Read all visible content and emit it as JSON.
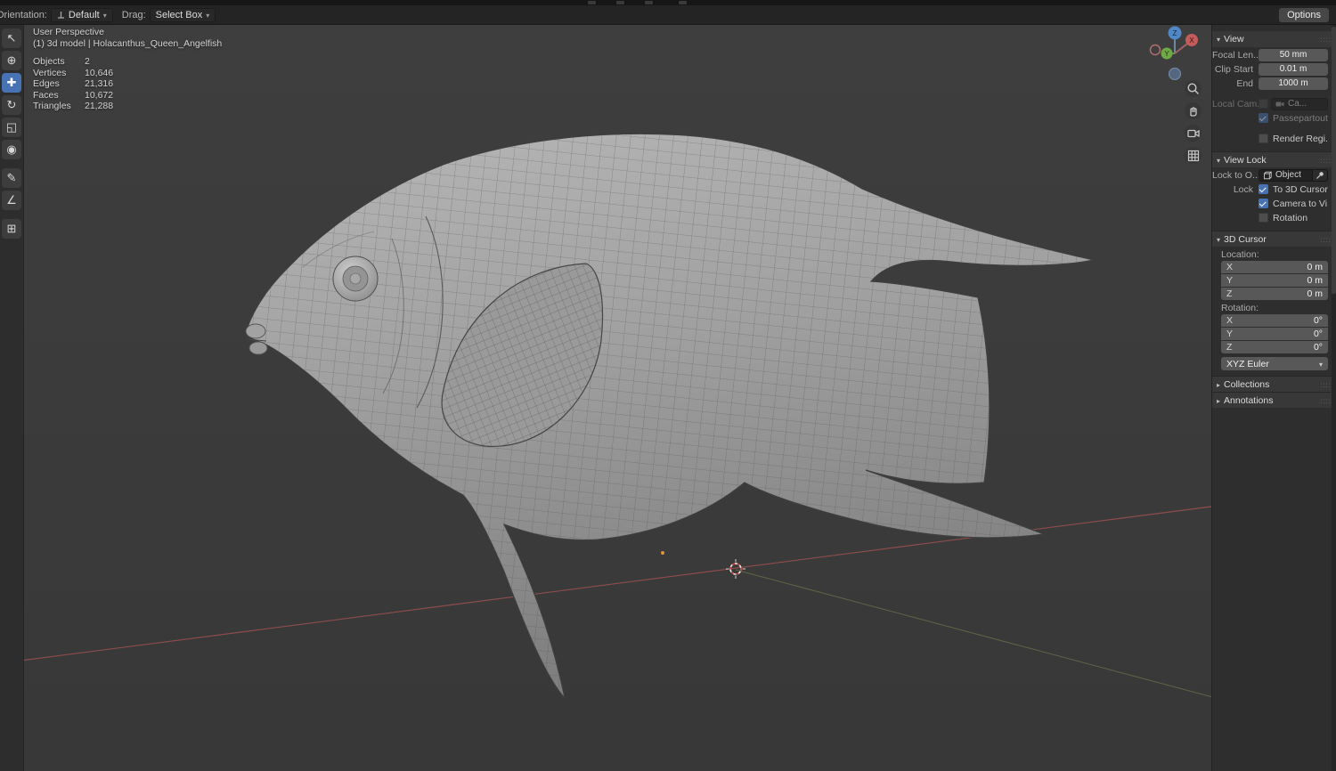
{
  "colors": {
    "accent": "#4772b3",
    "axis_x": "#b14d4d",
    "axis_y": "#7d8f55",
    "viewport_bg": "#3b3b3b"
  },
  "header": {
    "orientation_label": "Orientation:",
    "orientation_value": "Default",
    "drag_label": "Drag:",
    "drag_value": "Select Box",
    "options_button": "Options"
  },
  "toolbar": {
    "tools": [
      {
        "name": "select-box",
        "glyph": "↖"
      },
      {
        "name": "cursor",
        "glyph": "⊕"
      },
      {
        "name": "move",
        "glyph": "✚"
      },
      {
        "name": "rotate",
        "glyph": "↻"
      },
      {
        "name": "scale",
        "glyph": "◱"
      },
      {
        "name": "transform",
        "glyph": "◉"
      },
      {
        "name": "annotate",
        "glyph": "✎"
      },
      {
        "name": "measure",
        "glyph": "∠"
      },
      {
        "name": "add-cube",
        "glyph": "⊞"
      }
    ]
  },
  "overlay": {
    "perspective": "User Perspective",
    "scene": "(1) 3d model | Holacanthus_Queen_Angelfish",
    "stats": [
      {
        "label": "Objects",
        "value": "2"
      },
      {
        "label": "Vertices",
        "value": "10,646"
      },
      {
        "label": "Edges",
        "value": "21,316"
      },
      {
        "label": "Faces",
        "value": "10,672"
      },
      {
        "label": "Triangles",
        "value": "21,288"
      }
    ]
  },
  "gizmo": {
    "z": "Z",
    "y": "Y",
    "x": "X"
  },
  "sidebar": {
    "view": {
      "title": "View",
      "rows": [
        {
          "label": "Focal Len...",
          "value": "50 mm"
        },
        {
          "label": "Clip Start",
          "value": "0.01 m"
        },
        {
          "label": "End",
          "value": "1000 m"
        }
      ],
      "local_camera": {
        "label": "Local Cam...",
        "value": "Ca..."
      },
      "passepartout": "Passepartout",
      "render_region": "Render Regi..."
    },
    "view_lock": {
      "title": "View Lock",
      "lock_to_label": "Lock to O...",
      "lock_to_value": "Object",
      "lock_label": "Lock",
      "to_3d_cursor": "To 3D Cursor",
      "camera_to_view": "Camera to Vi...",
      "rotation": "Rotation"
    },
    "cursor3d": {
      "title": "3D Cursor",
      "location_label": "Location:",
      "location": [
        {
          "axis": "X",
          "value": "0 m"
        },
        {
          "axis": "Y",
          "value": "0 m"
        },
        {
          "axis": "Z",
          "value": "0 m"
        }
      ],
      "rotation_label": "Rotation:",
      "rotation": [
        {
          "axis": "X",
          "value": "0°"
        },
        {
          "axis": "Y",
          "value": "0°"
        },
        {
          "axis": "Z",
          "value": "0°"
        }
      ],
      "euler": "XYZ Euler"
    },
    "collections": "Collections",
    "annotations": "Annotations"
  }
}
